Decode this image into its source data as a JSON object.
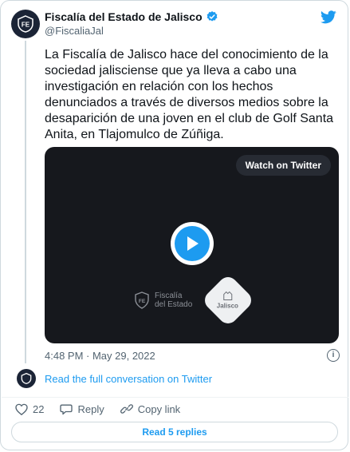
{
  "account": {
    "name": "Fiscalía del Estado de Jalisco",
    "handle": "@FiscaliaJal",
    "avatar_text": "FE"
  },
  "tweet": {
    "text": "La Fiscalía de Jalisco hace del conocimiento de la\nsociedad jalisciense que ya lleva a cabo una\ninvestigación en relación con los hechos\ndenunciados a través de diversos medios sobre la\ndesaparición de una joven en el club de Golf  Santa\nAnita, en Tlajomulco de Zúñiga.",
    "timestamp": "4:48 PM · May 29, 2022"
  },
  "media": {
    "watch_label": "Watch on Twitter",
    "logo_left_line1": "Fiscalía",
    "logo_left_line2": "del Estado",
    "logo_right": "Jalisco",
    "logo_badge_text": "FE"
  },
  "links": {
    "read_full": "Read the full conversation on Twitter",
    "read_replies": "Read 5 replies"
  },
  "actions": {
    "likes": "22",
    "reply_label": "Reply",
    "copy_label": "Copy link"
  },
  "info_icon_glyph": "i",
  "colors": {
    "accent": "#1d9bf0",
    "verified": "#1d9bf0",
    "like": "#536471",
    "media_bg": "#16181d"
  }
}
